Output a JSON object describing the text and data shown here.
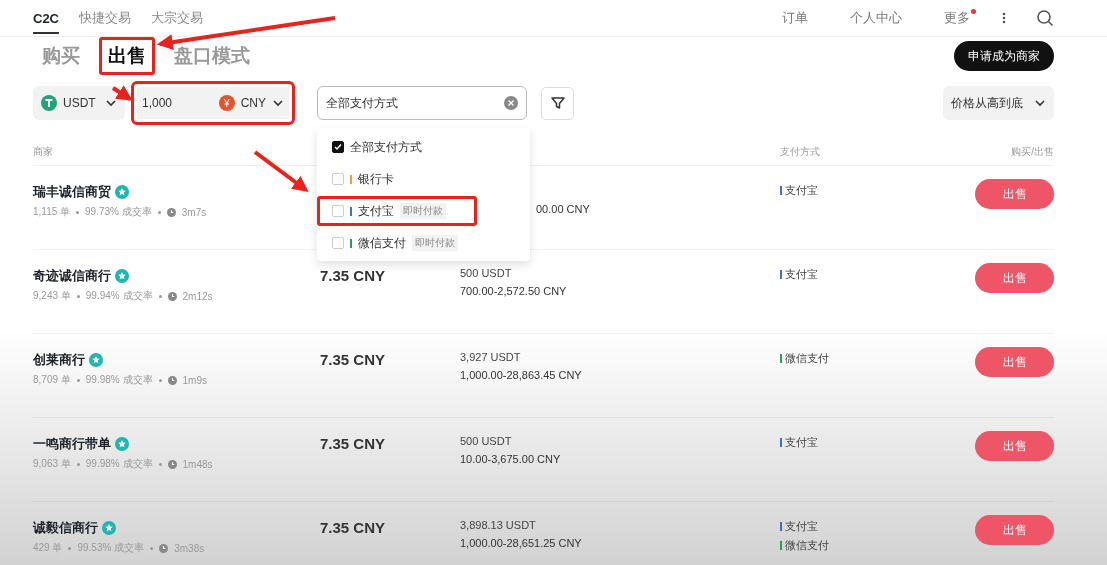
{
  "nav": {
    "items": [
      {
        "label": "C2C",
        "selected": true
      },
      {
        "label": "快捷交易",
        "selected": false
      },
      {
        "label": "大宗交易",
        "selected": false
      }
    ],
    "right": [
      {
        "label": "订单",
        "badge": false
      },
      {
        "label": "个人中心",
        "badge": false
      },
      {
        "label": "更多",
        "badge": true
      }
    ]
  },
  "tabs": [
    {
      "label": "购买",
      "selected": false,
      "highlighted": false
    },
    {
      "label": "出售",
      "selected": true,
      "highlighted": true
    },
    {
      "label": "盘口模式",
      "selected": false,
      "highlighted": false
    }
  ],
  "apply_button": "申请成为商家",
  "filters": {
    "coin": "USDT",
    "amount": {
      "value": "1,000",
      "currency_symbol": "¥",
      "currency": "CNY",
      "highlighted": true
    },
    "payment": {
      "value": "全部支付方式"
    },
    "sort": "价格从高到底"
  },
  "payment_menu": {
    "options": [
      {
        "label": "全部支付方式",
        "checked": true,
        "highlighted": false
      },
      {
        "label": "银行卡",
        "checked": false,
        "color": "#e8a33c",
        "highlighted": false
      },
      {
        "label": "支付宝",
        "checked": false,
        "color": "#3b6fd1",
        "tag": "即时付款",
        "highlighted": true
      },
      {
        "label": "微信支付",
        "checked": false,
        "color": "#2a9d5c",
        "tag": "即时付款",
        "highlighted": false
      }
    ]
  },
  "table": {
    "columns": [
      "商家",
      "支付方式",
      "购买/出售"
    ],
    "rows": [
      {
        "merchant": "瑞丰诚信商贸",
        "orders": "1,115 单",
        "completion": "99.73% 成交率",
        "time": "3m7s",
        "limit": "00.00 CNY",
        "payments": [
          {
            "label": "支付宝",
            "color": "#3b6fd1"
          }
        ],
        "action": "出售"
      },
      {
        "merchant": "奇迹诚信商行",
        "orders": "9,243 单",
        "completion": "99.94% 成交率",
        "time": "2m12s",
        "price": "7.35 CNY",
        "available": "500 USDT",
        "limit": "700.00-2,572.50 CNY",
        "payments": [
          {
            "label": "支付宝",
            "color": "#3b6fd1"
          }
        ],
        "action": "出售"
      },
      {
        "merchant": "创莱商行",
        "orders": "8,709 单",
        "completion": "99.98% 成交率",
        "time": "1m9s",
        "price": "7.35 CNY",
        "available": "3,927 USDT",
        "limit": "1,000.00-28,863.45 CNY",
        "payments": [
          {
            "label": "微信支付",
            "color": "#2a9d5c"
          }
        ],
        "action": "出售"
      },
      {
        "merchant": "一鸣商行带单",
        "orders": "9,063 单",
        "completion": "99.98% 成交率",
        "time": "1m48s",
        "price": "7.35 CNY",
        "available": "500 USDT",
        "limit": "10.00-3,675.00 CNY",
        "payments": [
          {
            "label": "支付宝",
            "color": "#3b6fd1"
          }
        ],
        "action": "出售"
      },
      {
        "merchant": "诚毅信商行",
        "orders": "429 单",
        "completion": "99.53% 成交率",
        "time": "3m38s",
        "price": "7.35 CNY",
        "available": "3,898.13 USDT",
        "limit": "1,000.00-28,651.25 CNY",
        "payments": [
          {
            "label": "支付宝",
            "color": "#3b6fd1"
          },
          {
            "label": "微信支付",
            "color": "#2a9d5c"
          }
        ],
        "action": "出售"
      }
    ]
  }
}
